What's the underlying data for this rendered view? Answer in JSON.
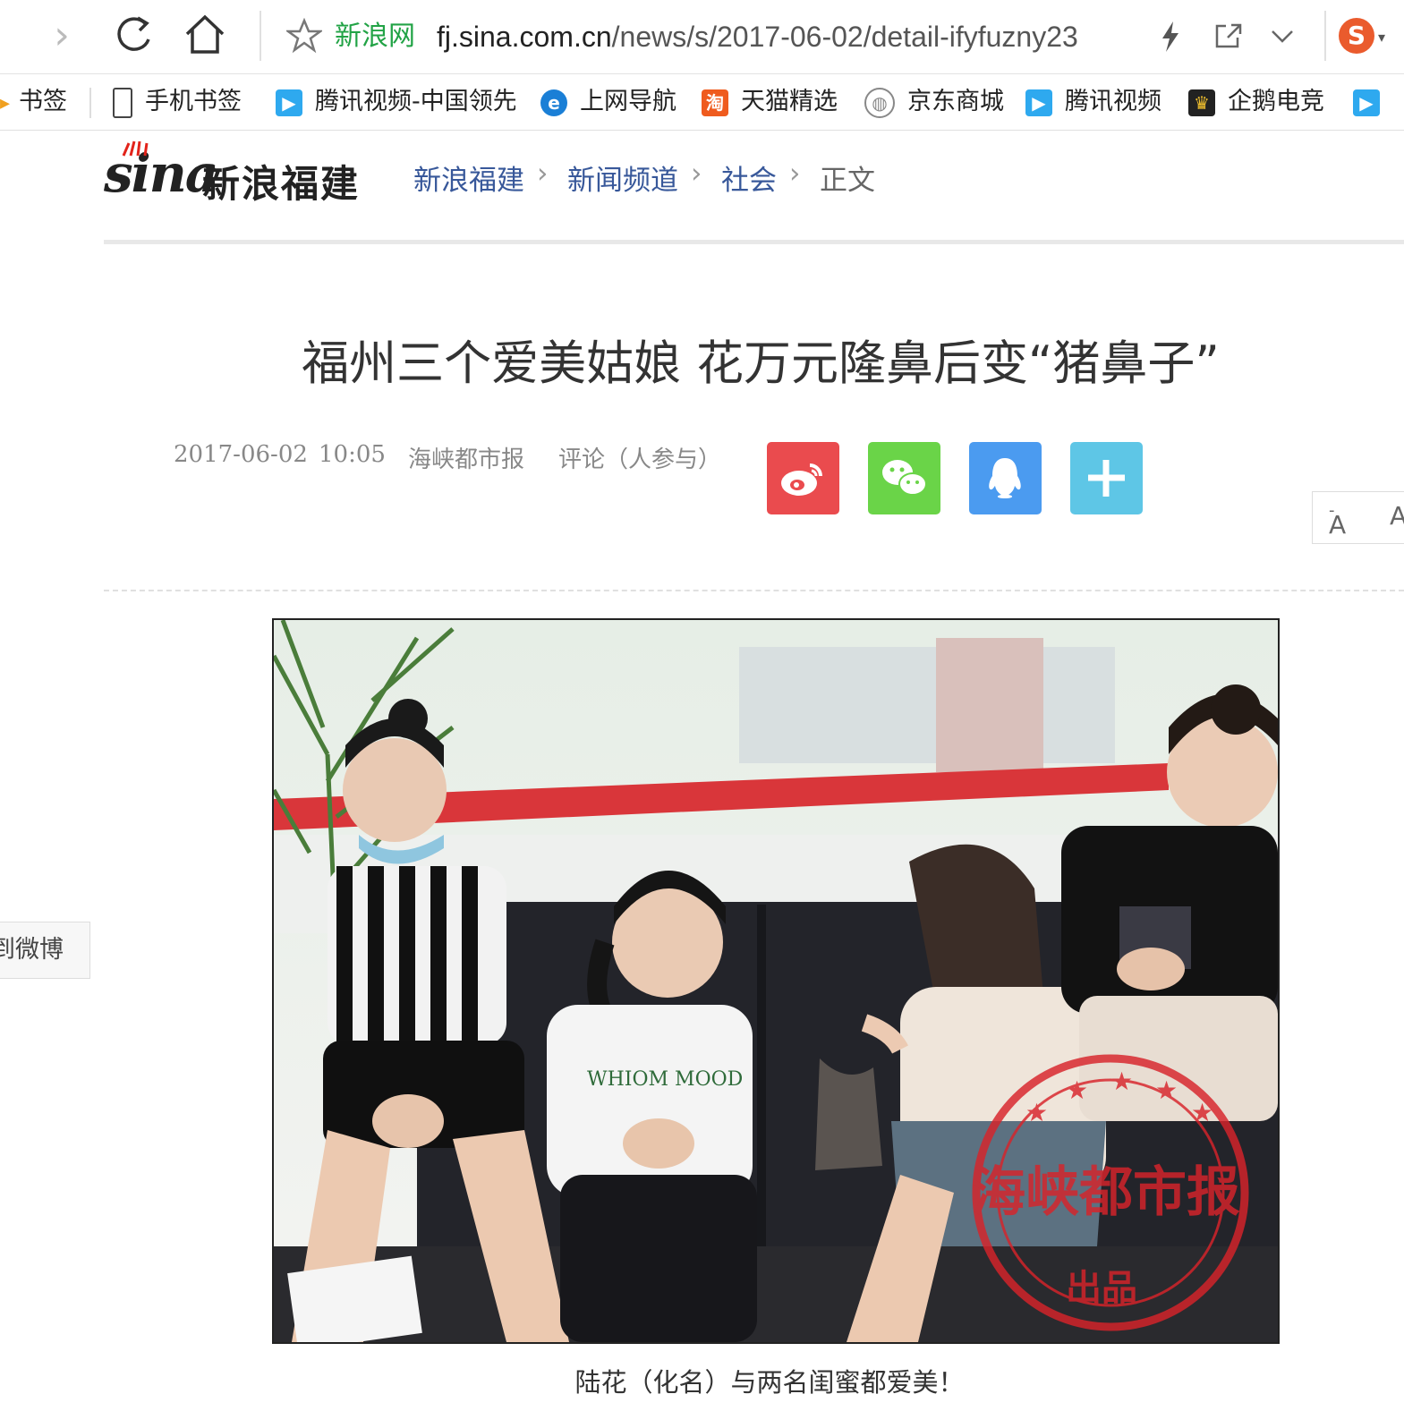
{
  "browser": {
    "address_site_label": "新浪网",
    "url_domain": "fj.sina.com.cn",
    "url_path": "/news/s/2017-06-02/detail-ifyfuzny23",
    "bookmarks": [
      {
        "label": "书签"
      },
      {
        "label": "手机书签"
      },
      {
        "label": "腾讯视频-中国领先"
      },
      {
        "label": "上网导航"
      },
      {
        "label": "天猫精选"
      },
      {
        "label": "京东商城"
      },
      {
        "label": "腾讯视频"
      },
      {
        "label": "企鹅电竞"
      }
    ]
  },
  "site": {
    "logo_text": "sina",
    "logo_region": "新浪福建"
  },
  "breadcrumb": [
    "新浪福建",
    "新闻频道",
    "社会",
    "正文"
  ],
  "article": {
    "title": "福州三个爱美姑娘 花万元隆鼻后变“猪鼻子”",
    "date": "2017-06-02",
    "time": "10:05",
    "source": "海峡都市报",
    "comments": "评论（人参与）",
    "caption": "陆花（化名）与两名闺蜜都爱美！",
    "watermark": "海峡都市报",
    "watermark_sub": "出品"
  },
  "share_buttons": [
    {
      "name": "weibo",
      "color": "#ea4b4e"
    },
    {
      "name": "wechat",
      "color": "#6ad448"
    },
    {
      "name": "qq",
      "color": "#4b9bf0"
    },
    {
      "name": "more",
      "color": "#5ec6e6"
    }
  ],
  "font_size_control": {
    "decrease": "A",
    "increase": "A"
  },
  "side_tab": "到微博",
  "colors": {
    "accent_red": "#e2231a",
    "link_blue": "#38589a"
  }
}
